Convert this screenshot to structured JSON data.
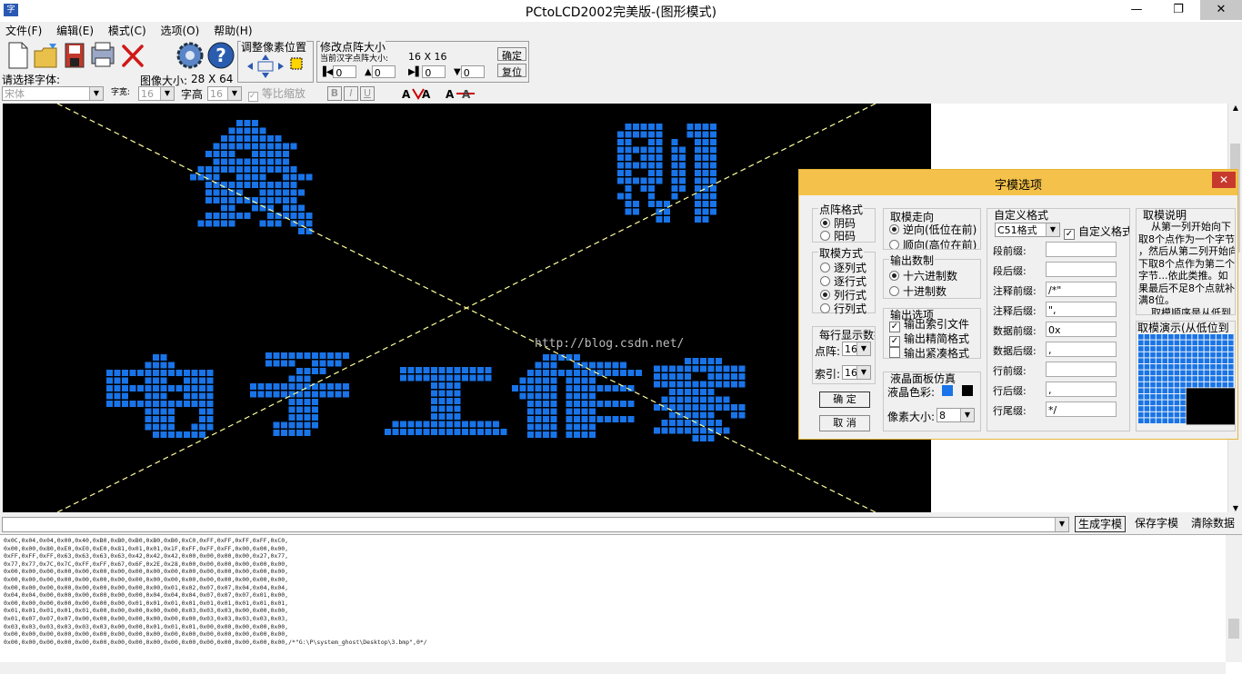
{
  "window": {
    "title": "PCtoLCD2002完美版-(图形模式)"
  },
  "menu": [
    "文件(F)",
    "编辑(E)",
    "模式(C)",
    "选项(O)",
    "帮助(H)"
  ],
  "toolbar": {
    "font_label": "请选择字体:",
    "font_value": "宋体",
    "width_label": "字宽:",
    "width_value": "16",
    "image_size_label": "图像大小:",
    "image_size_value": "28 X 64",
    "height_label": "字高",
    "height_value": "16",
    "scale_label": "等比缩放",
    "bold": "B",
    "italic": "I",
    "underline": "U",
    "adjust_pixel_label": "调整像素位置",
    "resize_label": "修改点阵大小",
    "current_size_label": "当前汉字点阵大小:",
    "current_size_value": "16 X 16",
    "confirm_button": "确定",
    "restore_button": "复位",
    "spin_values": [
      "0",
      "0",
      "0",
      "0"
    ]
  },
  "watermark": "http://blog.csdn.net/",
  "dialog": {
    "title": "字模选项",
    "dot_format": {
      "legend": "点阵格式",
      "options": [
        "阴码",
        "阳码"
      ],
      "selected": 0
    },
    "scan_mode": {
      "legend": "取模方式",
      "options": [
        "逐列式",
        "逐行式",
        "列行式",
        "行列式"
      ],
      "selected": 2
    },
    "per_line": {
      "legend": "每行显示数据",
      "dot_label": "点阵:",
      "dot_value": "16",
      "index_label": "索引:",
      "index_value": "16"
    },
    "ok_button": "确 定",
    "cancel_button": "取 消",
    "direction": {
      "legend": "取模走向",
      "options": [
        "逆向(低位在前)",
        "顺向(高位在前)"
      ],
      "selected": 0
    },
    "radix": {
      "legend": "输出数制",
      "options": [
        "十六进制数",
        "十进制数"
      ],
      "selected": 0
    },
    "output_opts": {
      "legend": "输出选项",
      "options": [
        "输出索引文件",
        "输出精简格式",
        "输出紧凑格式"
      ],
      "checked": [
        true,
        true,
        false
      ]
    },
    "lcd": {
      "legend": "液晶面板仿真",
      "color_label": "液晶色彩:",
      "pixel_label": "像素大小:",
      "pixel_value": "8",
      "fg_color": "#1874e8",
      "bg_color": "#000000"
    },
    "custom": {
      "legend": "自定义格式",
      "format_value": "C51格式",
      "custom_check": "自定义格式",
      "rows": [
        {
          "label": "段前缀:",
          "value": ""
        },
        {
          "label": "段后缀:",
          "value": ""
        },
        {
          "label": "注释前缀:",
          "value": "/*\""
        },
        {
          "label": "注释后缀:",
          "value": "\","
        },
        {
          "label": "数据前缀:",
          "value": "0x"
        },
        {
          "label": "数据后缀:",
          "value": ","
        },
        {
          "label": "行前缀:",
          "value": ""
        },
        {
          "label": "行后缀:",
          "value": ","
        },
        {
          "label": "行尾缀:",
          "value": "*/"
        }
      ]
    },
    "explain": {
      "legend": "取模说明",
      "text": [
        "从第一列开始向下",
        "取8个点作为一个字节",
        "，然后从第二列开始向",
        "下取8个点作为第二个",
        "字节...依此类推。如",
        "果最后不足8个点就补",
        "满8位。",
        "取模顺序是从低到"
      ]
    },
    "demo": {
      "legend": "取模演示(从低位到"
    }
  },
  "bottom": {
    "generate": "生成字模",
    "save": "保存字模",
    "clear": "清除数据"
  },
  "output_lines": [
    "0x0C,0x04,0x04,0x00,0x40,0xB0,0xB0,0xB0,0xB0,0xB0,0xC0,0xFF,0xFF,0xFF,0xFF,0xC0,",
    "0x00,0x00,0x80,0xE0,0xE0,0xE0,0x81,0x01,0x01,0x1F,0xFF,0xFF,0xFF,0x00,0x00,0x00,",
    "0xFF,0xFF,0xFF,0x63,0x63,0x63,0x63,0x42,0x42,0x42,0x00,0x00,0x00,0x00,0x27,0x77,",
    "0x77,0x77,0x7C,0x7C,0xFF,0xFF,0x67,0x6F,0x2E,0x28,0x00,0x00,0x00,0x00,0x00,0x00,",
    "0x00,0x00,0x00,0x00,0x00,0x00,0x00,0x00,0x00,0x00,0x00,0x00,0x00,0x00,0x00,0x00,",
    "0x00,0x00,0x00,0x00,0x00,0x00,0x00,0x00,0x00,0x00,0x00,0x00,0x00,0x00,0x00,0x00,",
    "0x00,0x00,0x00,0x00,0x00,0x00,0x00,0x00,0x00,0x01,0x02,0x07,0x07,0x04,0x04,0x04,",
    "0x04,0x04,0x00,0x00,0x00,0x00,0x00,0x00,0x04,0x04,0x04,0x07,0x07,0x07,0x01,0x00,",
    "0x00,0x00,0x00,0x00,0x00,0x00,0x00,0x01,0x01,0x01,0x01,0x01,0x01,0x01,0x01,0x01,",
    "0x01,0x01,0x01,0x01,0x01,0x00,0x00,0x00,0x00,0x00,0x03,0x03,0x03,0x00,0x00,0x00,",
    "0x01,0x07,0x07,0x07,0x00,0x00,0x00,0x00,0x00,0x00,0x00,0x03,0x03,0x03,0x03,0x03,",
    "0x03,0x03,0x03,0x03,0x03,0x03,0x00,0x00,0x01,0x01,0x01,0x00,0x00,0x00,0x00,0x00,",
    "0x00,0x00,0x00,0x00,0x00,0x00,0x00,0x00,0x00,0x00,0x00,0x00,0x00,0x00,0x00,0x00,",
    "0x00,0x00,0x00,0x00,0x00,0x00,0x00,0x00,0x00,0x00,0x00,0x00,0x00,0x00,0x00,0x00,/*\"G:\\P\\system_ghost\\Desktop\\3.bmp\",0*/"
  ]
}
